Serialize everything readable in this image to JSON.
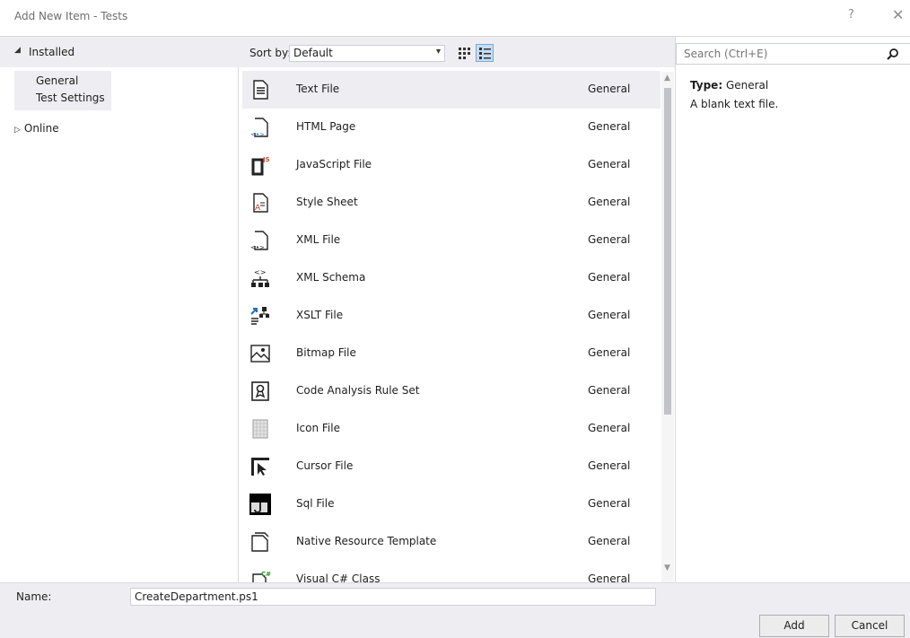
{
  "window": {
    "title": "Add New Item - Tests",
    "help": "?",
    "close": "✕"
  },
  "sidebar": {
    "installed_label": "Installed",
    "items": [
      {
        "label": "General",
        "selected": true
      },
      {
        "label": "Test Settings",
        "selected": false
      }
    ],
    "online_label": "Online"
  },
  "toolbar": {
    "sort_label": "Sort by:",
    "sort_value": "Default"
  },
  "templates": [
    {
      "name": "Text File",
      "category": "General",
      "icon": "text-file-icon",
      "selected": true
    },
    {
      "name": "HTML Page",
      "category": "General",
      "icon": "html-page-icon"
    },
    {
      "name": "JavaScript File",
      "category": "General",
      "icon": "javascript-file-icon"
    },
    {
      "name": "Style Sheet",
      "category": "General",
      "icon": "style-sheet-icon"
    },
    {
      "name": "XML File",
      "category": "General",
      "icon": "xml-file-icon"
    },
    {
      "name": "XML Schema",
      "category": "General",
      "icon": "xml-schema-icon"
    },
    {
      "name": "XSLT File",
      "category": "General",
      "icon": "xslt-file-icon"
    },
    {
      "name": "Bitmap File",
      "category": "General",
      "icon": "bitmap-file-icon"
    },
    {
      "name": "Code Analysis Rule Set",
      "category": "General",
      "icon": "code-analysis-icon"
    },
    {
      "name": "Icon File",
      "category": "General",
      "icon": "icon-file-icon"
    },
    {
      "name": "Cursor File",
      "category": "General",
      "icon": "cursor-file-icon"
    },
    {
      "name": "Sql File",
      "category": "General",
      "icon": "sql-file-icon"
    },
    {
      "name": "Native Resource Template",
      "category": "General",
      "icon": "native-resource-icon"
    },
    {
      "name": "Visual C# Class",
      "category": "General",
      "icon": "csharp-class-icon"
    }
  ],
  "details": {
    "search_placeholder": "Search (Ctrl+E)",
    "type_label": "Type:",
    "type_value": "General",
    "description": "A blank text file."
  },
  "footer": {
    "name_label": "Name:",
    "name_value": "CreateDepartment.ps1",
    "add_label": "Add",
    "cancel_label": "Cancel"
  }
}
